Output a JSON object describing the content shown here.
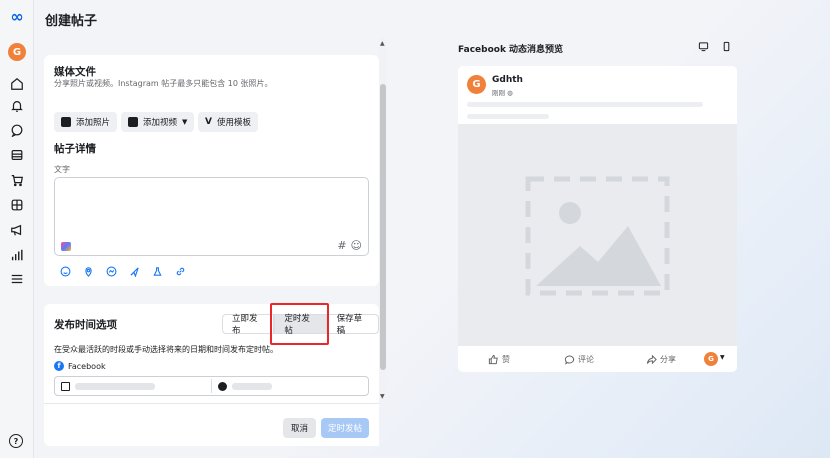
{
  "header": {
    "title": "创建帖子"
  },
  "rail": {
    "logo": "∞",
    "avatar_letter": "G",
    "icons": [
      "home-icon",
      "bell-icon",
      "chat-icon",
      "pages-icon",
      "cart-icon",
      "grid-icon",
      "megaphone-icon",
      "insights-icon",
      "menu-icon"
    ],
    "help": "?"
  },
  "media": {
    "title": "媒体文件",
    "subtitle": "分享照片或视频。Instagram 帖子最多只能包含 10 张照片。",
    "add_photo": "添加照片",
    "add_video": "添加视频",
    "use_template": "使用模板"
  },
  "details": {
    "title": "帖子详情",
    "text_label": "文字",
    "hash": "#",
    "smile": "☺"
  },
  "schedule": {
    "title": "发布时间选项",
    "options": [
      "立即发布",
      "定时发帖",
      "保存草稿"
    ],
    "selected": "定时发帖",
    "description": "在受众最活跃的时段或手动选择将来的日期和时间发布定时帖。",
    "platform": "Facebook"
  },
  "footer": {
    "cancel": "取消",
    "submit": "定时发帖"
  },
  "preview": {
    "title": "Facebook 动态消息预览",
    "page_name": "Gdhth",
    "time": "刚刚",
    "avatar_letter": "G",
    "like": "赞",
    "comment": "评论",
    "share": "分享"
  },
  "colors": {
    "accent": "#1877f2",
    "avatar": "#f0813a",
    "highlight": "#e8282b"
  }
}
